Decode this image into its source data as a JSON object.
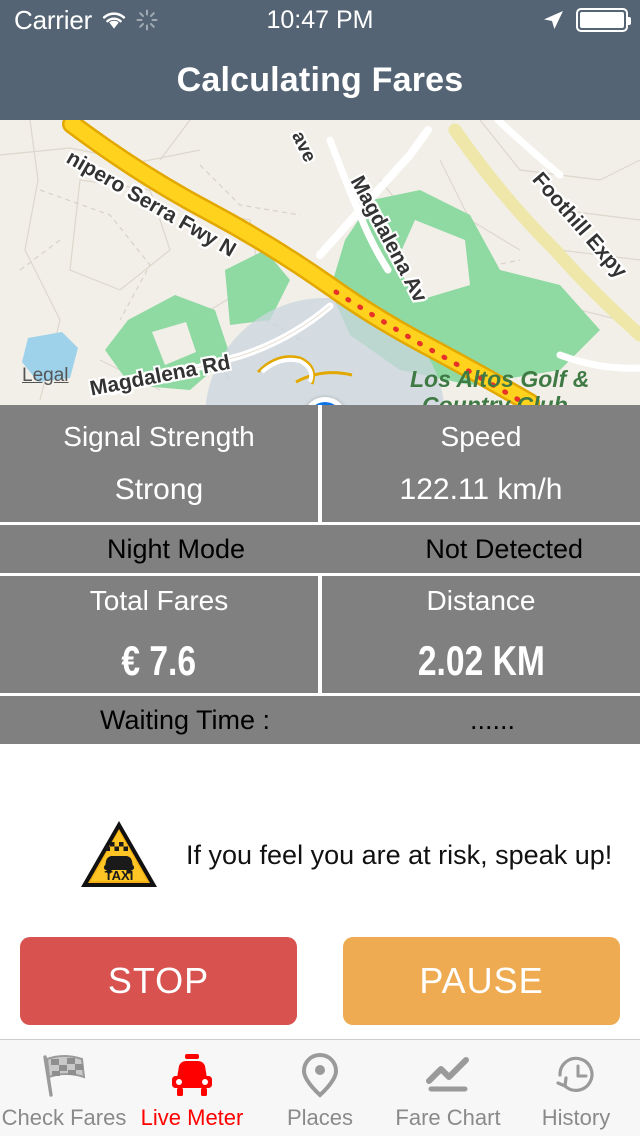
{
  "status_bar": {
    "carrier": "Carrier",
    "time": "10:47 PM",
    "wifi_icon": "wifi-icon",
    "activity_icon": "activity-spinner-icon",
    "location_icon": "location-arrow-icon",
    "battery_icon": "battery-full-icon"
  },
  "nav": {
    "title": "Calculating Fares",
    "background_color": "#546475"
  },
  "map": {
    "legal_link": "Legal",
    "labels": [
      {
        "text": "nipero Serra Fwy N",
        "type": "road"
      },
      {
        "text": "Magdalena Rd",
        "type": "road"
      },
      {
        "text": "Magdalena Av",
        "type": "road"
      },
      {
        "text": "ave",
        "type": "road"
      },
      {
        "text": "Foothill Expy",
        "type": "road"
      },
      {
        "text": "Los Altos Golf &",
        "type": "place"
      },
      {
        "text": "Country Club",
        "type": "place"
      }
    ],
    "user_location_marker": "blue-dot",
    "poi_marker": "golf-course-icon"
  },
  "panels": {
    "background_color": "#808080",
    "rows": [
      {
        "type": "double",
        "cells": [
          {
            "label": "Signal Strength",
            "value": "Strong"
          },
          {
            "label": "Speed",
            "value": "122.11 km/h"
          }
        ]
      },
      {
        "type": "inline",
        "label": "Night Mode",
        "value": "Not Detected"
      },
      {
        "type": "double",
        "cells": [
          {
            "label": "Total Fares",
            "value": "€ 7.6"
          },
          {
            "label": "Distance",
            "value": "2.02 KM"
          }
        ]
      },
      {
        "type": "inline",
        "label": "Waiting Time :",
        "value": "......"
      }
    ]
  },
  "warning": {
    "icon": "taxi-warning-triangle-icon",
    "icon_text": "TAXI",
    "message": "If you feel you are at risk, speak up!"
  },
  "actions": {
    "stop_label": "STOP",
    "stop_color": "#d8534f",
    "pause_label": "PAUSE",
    "pause_color": "#eeab52"
  },
  "tabbar": {
    "active_color": "#ff0000",
    "inactive_color": "#8a8a8a",
    "items": [
      {
        "label": "Check Fares",
        "icon": "checkered-flag-icon",
        "active": false
      },
      {
        "label": "Live Meter",
        "icon": "taxi-car-icon",
        "active": true
      },
      {
        "label": "Places",
        "icon": "map-pin-icon",
        "active": false
      },
      {
        "label": "Fare Chart",
        "icon": "line-chart-icon",
        "active": false
      },
      {
        "label": "History",
        "icon": "clock-rewind-icon",
        "active": false
      }
    ]
  }
}
